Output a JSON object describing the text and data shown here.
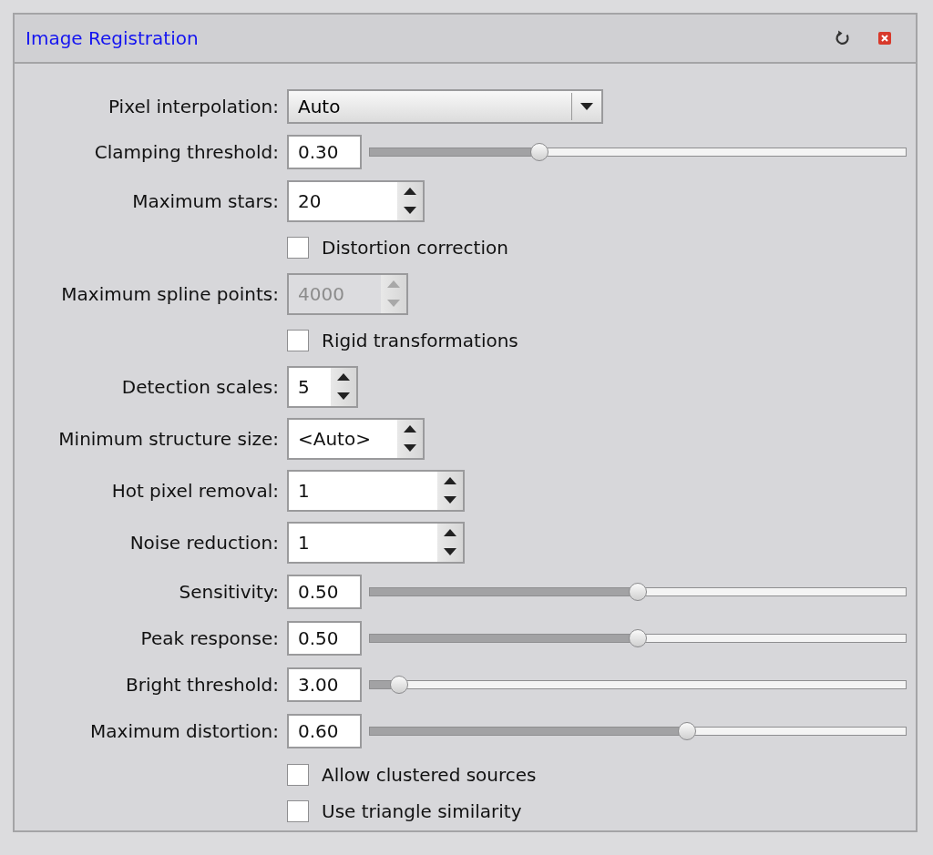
{
  "window": {
    "title": "Image Registration"
  },
  "rows": [
    {
      "kind": "combo",
      "label": "Pixel interpolation:",
      "value": "Auto"
    },
    {
      "kind": "slider",
      "label": "Clamping threshold:",
      "value": "0.30",
      "level": 0.31
    },
    {
      "kind": "spin",
      "label": "Maximum stars:",
      "value": "20",
      "disabled": false
    },
    {
      "kind": "check",
      "label": "Distortion correction",
      "checked": false
    },
    {
      "kind": "spin",
      "label": "Maximum spline points:",
      "value": "4000",
      "disabled": true
    },
    {
      "kind": "check",
      "label": "Rigid transformations",
      "checked": false
    },
    {
      "kind": "spin",
      "label": "Detection scales:",
      "value": "5",
      "disabled": false
    },
    {
      "kind": "spin",
      "label": "Minimum structure size:",
      "value": "<Auto>",
      "disabled": false
    },
    {
      "kind": "spin",
      "label": "Hot pixel removal:",
      "value": "1",
      "disabled": false
    },
    {
      "kind": "spin",
      "label": "Noise reduction:",
      "value": "1",
      "disabled": false
    },
    {
      "kind": "slider",
      "label": "Sensitivity:",
      "value": "0.50",
      "level": 0.5
    },
    {
      "kind": "slider",
      "label": "Peak response:",
      "value": "0.50",
      "level": 0.5
    },
    {
      "kind": "slider",
      "label": "Bright threshold:",
      "value": "3.00",
      "level": 0.04
    },
    {
      "kind": "slider",
      "label": "Maximum distortion:",
      "value": "0.60",
      "level": 0.595
    },
    {
      "kind": "check",
      "label": "Allow clustered sources",
      "checked": false
    },
    {
      "kind": "check",
      "label": "Use triangle similarity",
      "checked": false
    }
  ]
}
